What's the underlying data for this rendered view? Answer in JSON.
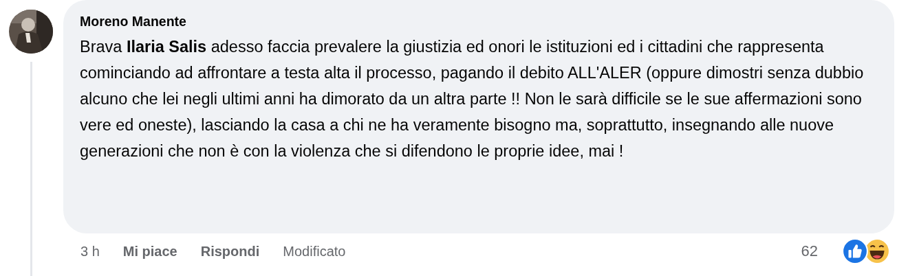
{
  "comment": {
    "author": "Moreno Manente",
    "text": "Brava **Ilaria Salis** adesso faccia prevalere la giustizia ed onori le istituzioni ed i cittadini che rappresenta cominciando ad affrontare a testa alta il processo, pagando il debito ALL'ALER (oppure dimostri senza dubbio alcuno che lei negli ultimi anni ha dimorato da un altra parte !! Non le sarà difficile se le sue affermazioni sono vere ed oneste), lasciando la casa a chi ne ha veramente bisogno ma, soprattutto, insegnando alle nuove generazioni che non è con la violenza che si difendono le proprie idee, mai !",
    "time": "3 h",
    "like_label": "Mi piace",
    "reply_label": "Rispondi",
    "edited_label": "Modificato",
    "reaction_count": "62",
    "reactions": [
      {
        "kind": "like"
      },
      {
        "kind": "haha"
      }
    ]
  }
}
